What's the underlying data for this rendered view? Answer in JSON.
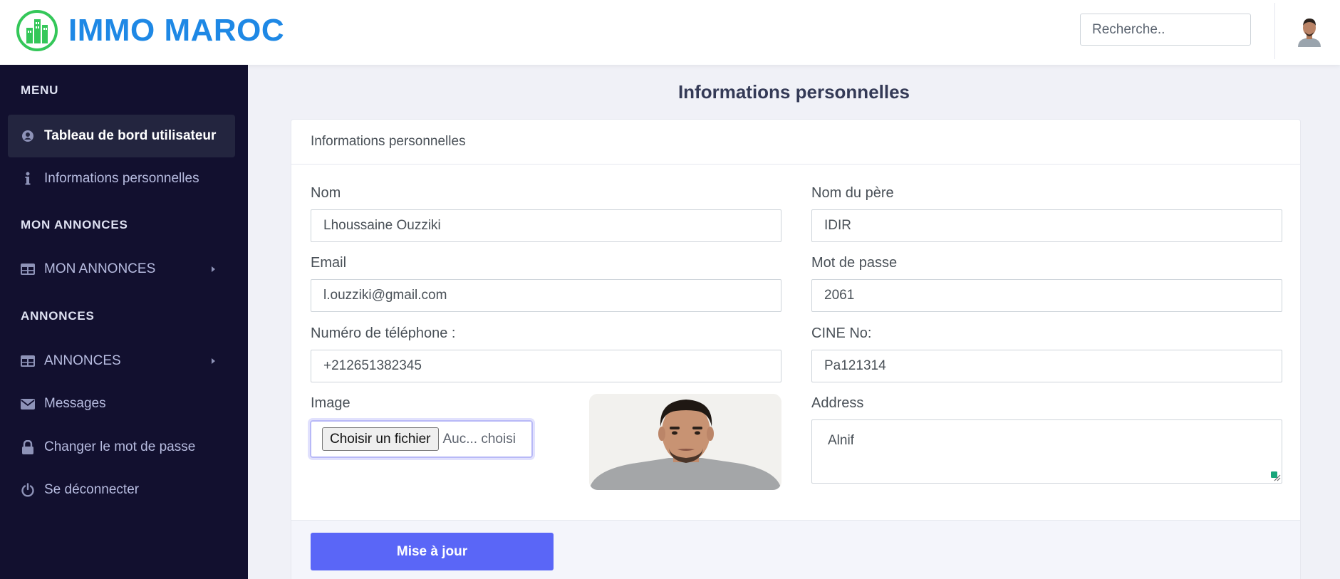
{
  "header": {
    "brand": "IMMO MAROC",
    "brand_color": "#1e88e5",
    "search_placeholder": "Recherche..",
    "avatar_icon": "user-avatar"
  },
  "sidebar": {
    "headings": [
      "MENU",
      "MON ANNONCES",
      "ANNONCES"
    ],
    "items": [
      {
        "label": "Tableau de bord utilisateur",
        "icon": "user-circle-icon",
        "active": true
      },
      {
        "label": "Informations personnelles",
        "icon": "info-icon"
      },
      {
        "label": "MON ANNONCES",
        "icon": "table-icon",
        "has_submenu": true
      },
      {
        "label": "ANNONCES",
        "icon": "table-icon",
        "has_submenu": true
      },
      {
        "label": "Messages",
        "icon": "envelope-icon"
      },
      {
        "label": "Changer le mot de passe",
        "icon": "lock-icon"
      },
      {
        "label": "Se déconnecter",
        "icon": "power-icon"
      }
    ],
    "background": "#12102f"
  },
  "main": {
    "page_title": "Informations personnelles",
    "card_title": "Informations personnelles",
    "fields": {
      "nom": {
        "label": "Nom",
        "value": "Lhoussaine Ouzziki"
      },
      "nom_pere": {
        "label": "Nom du père",
        "value": "IDIR"
      },
      "email": {
        "label": "Email",
        "value": "l.ouzziki@gmail.com"
      },
      "mot_de_passe": {
        "label": "Mot de passe",
        "value": "2061"
      },
      "telephone": {
        "label": "Numéro de téléphone :",
        "value": "+212651382345"
      },
      "cine": {
        "label": "CINE No:",
        "value": "Pa121314"
      },
      "image": {
        "label": "Image",
        "button": "Choisir un fichier",
        "status": "Auc... choisi"
      },
      "address": {
        "label": "Address",
        "value": "Alnif"
      }
    },
    "submit_label": "Mise à jour",
    "accent_color": "#5a66f7"
  }
}
